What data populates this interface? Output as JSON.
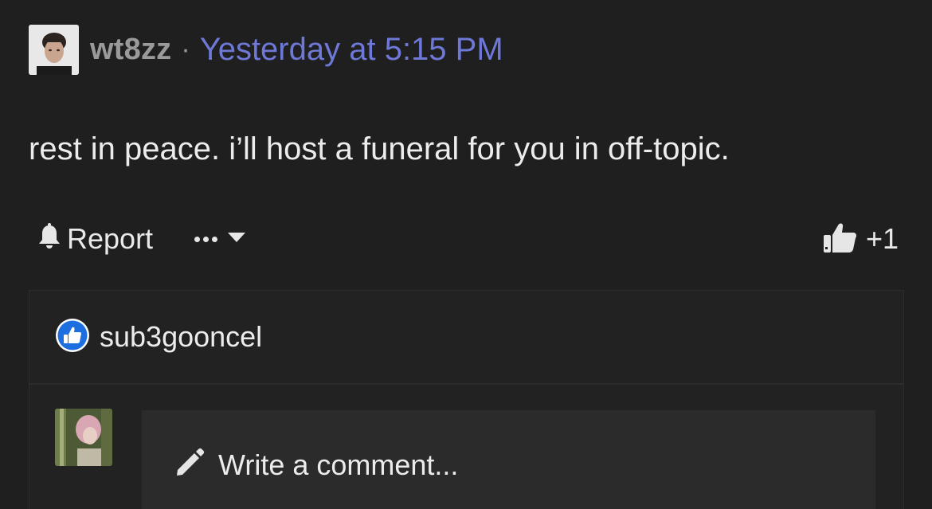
{
  "post": {
    "author": "wt8zz",
    "separator": "·",
    "timestamp": "Yesterday at 5:15 PM",
    "body": "rest in peace. i’ll host a funeral for you in off-topic."
  },
  "actions": {
    "report_label": "Report",
    "like_count": "+1"
  },
  "reactions": {
    "users": [
      "sub3gooncel"
    ]
  },
  "comment": {
    "placeholder": "Write a comment..."
  },
  "colors": {
    "background": "#1f1f1f",
    "timestamp": "#6e78d6",
    "like_badge": "#1d6fe0"
  },
  "icons": {
    "report": "bell-icon",
    "more": "ellipsis-icon",
    "dropdown": "chevron-down-icon",
    "like": "thumbs-up-icon",
    "reaction": "like-badge-icon",
    "write": "pencil-icon"
  }
}
